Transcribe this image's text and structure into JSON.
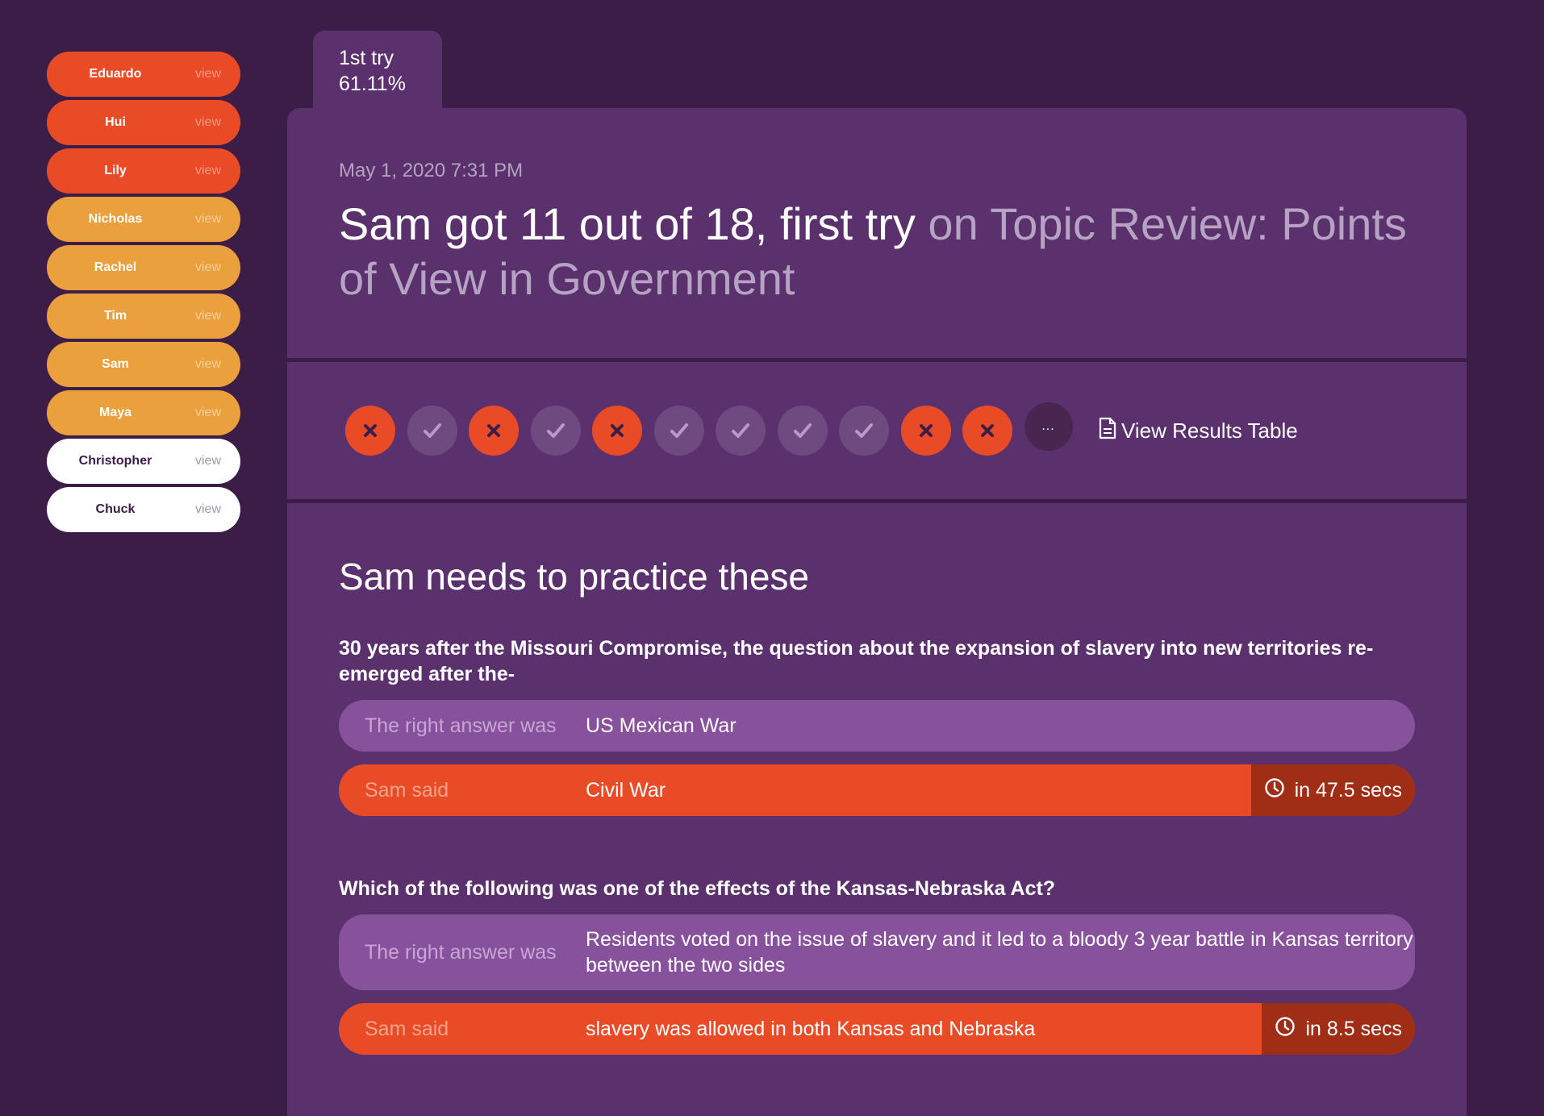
{
  "sidebar": {
    "students": [
      {
        "name": "Eduardo",
        "action": "view",
        "status": "red"
      },
      {
        "name": "Hui",
        "action": "view",
        "status": "red"
      },
      {
        "name": "Lily",
        "action": "view",
        "status": "red"
      },
      {
        "name": "Nicholas",
        "action": "view",
        "status": "orange"
      },
      {
        "name": "Rachel",
        "action": "view",
        "status": "orange"
      },
      {
        "name": "Tim",
        "action": "view",
        "status": "orange"
      },
      {
        "name": "Sam",
        "action": "view",
        "status": "orange"
      },
      {
        "name": "Maya",
        "action": "view",
        "status": "orange"
      },
      {
        "name": "Christopher",
        "action": "view",
        "status": "white"
      },
      {
        "name": "Chuck",
        "action": "view",
        "status": "white"
      }
    ]
  },
  "tab": {
    "label": "1st try",
    "score": "61.11%"
  },
  "header": {
    "date": "May 1, 2020 7:31 PM",
    "title_main": "Sam got 11 out of 18, first try",
    "title_sub": "on Topic Review: Points of View in Government"
  },
  "results": {
    "answers": [
      "wrong",
      "right",
      "wrong",
      "right",
      "wrong",
      "right",
      "right",
      "right",
      "right",
      "wrong",
      "wrong"
    ],
    "more_label": "...",
    "view_table_label": "View Results Table"
  },
  "practice": {
    "title": "Sam needs to practice these",
    "right_label": "The right answer was",
    "said_label": "Sam said",
    "questions": [
      {
        "question": "30 years after the Missouri Compromise, the question about the expansion of slavery into new territories re-emerged after the-",
        "right_answer": "US Mexican War",
        "student_answer": "Civil War",
        "time": "in 47.5 secs"
      },
      {
        "question": "Which of the following was one of the effects of the Kansas-Nebraska Act?",
        "right_answer": "Residents voted on the issue of slavery and it led to a bloody 3 year battle in Kansas territory between the two sides",
        "student_answer": "slavery was allowed in both Kansas and Nebraska",
        "time": "in 8.5 secs"
      }
    ]
  },
  "colors": {
    "background": "#3b1d47",
    "panel": "#5a316c",
    "wrong": "#e94b27",
    "warning": "#e9a03d",
    "right_answer_bg": "#87519c",
    "time_bg": "#a02e17"
  }
}
